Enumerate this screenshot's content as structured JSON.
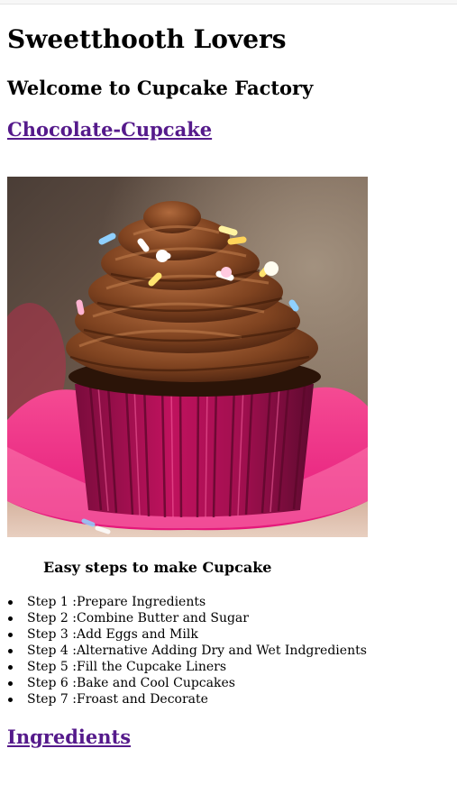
{
  "site": {
    "title": "Sweetthooth Lovers",
    "subtitle": "Welcome to Cupcake Factory"
  },
  "links": {
    "chocolate": "Chocolate-Cupcake",
    "ingredients": "Ingredients"
  },
  "image": {
    "subject": "chocolate cupcake with pink liner"
  },
  "steps": {
    "title": "Easy steps to make Cupcake",
    "items": [
      "Step 1 :Prepare Ingredients",
      "Step 2 :Combine Butter and Sugar",
      "Step 3 :Add Eggs and Milk",
      "Step 4 :Alternative Adding Dry and Wet Indgredients",
      "Step 5 :Fill the Cupcake Liners",
      "Step 6 :Bake and Cool Cupcakes",
      "Step 7 :Froast and Decorate"
    ]
  },
  "colors": {
    "link": "#551a8b",
    "liner": "#e0126e",
    "frosting": "#7a3f1e"
  }
}
